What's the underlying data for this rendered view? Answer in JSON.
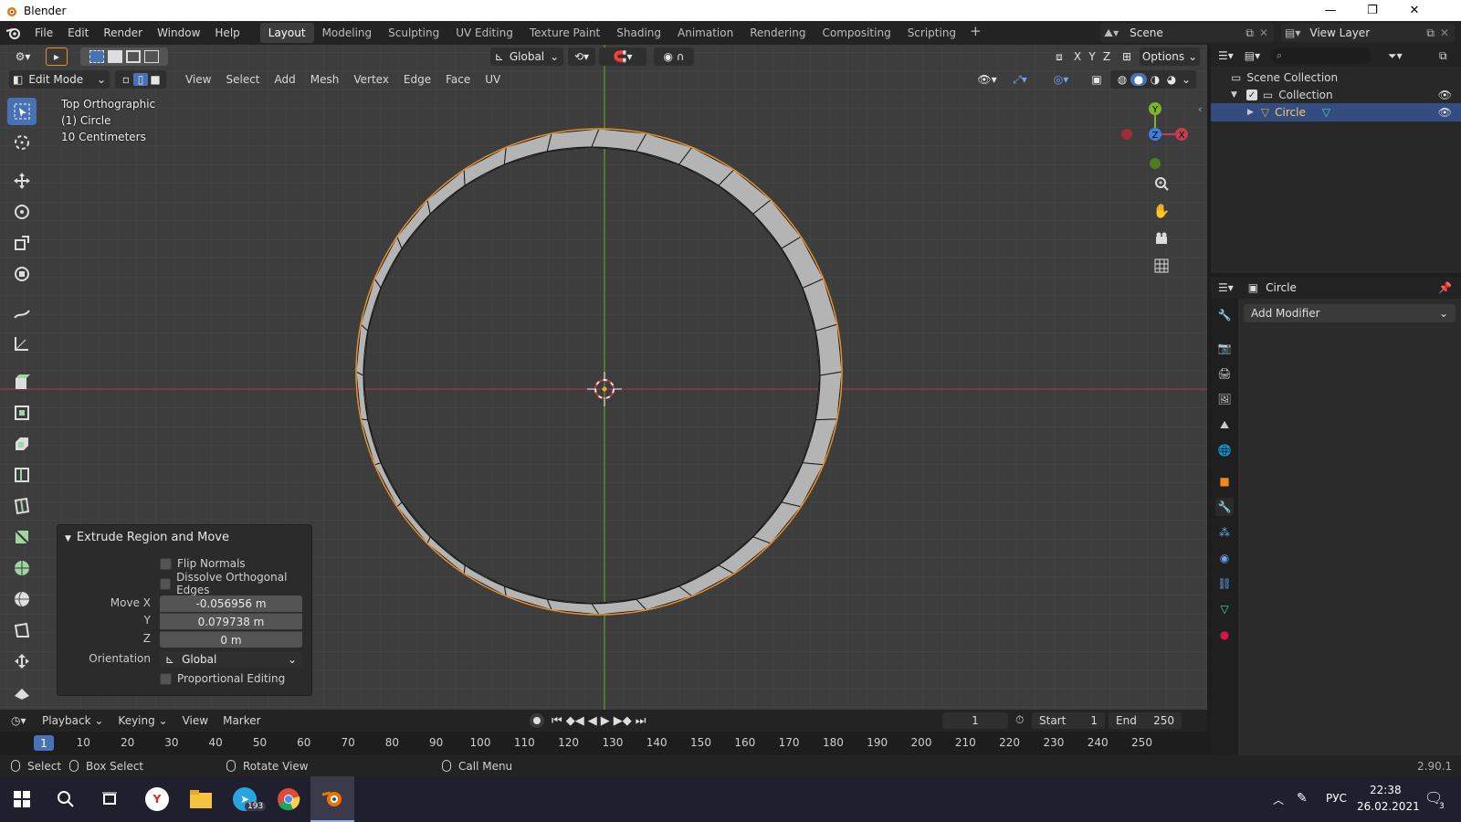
{
  "window": {
    "title": "Blender",
    "minimize": "—",
    "maximize": "❐",
    "close": "✕"
  },
  "menu": [
    "File",
    "Edit",
    "Render",
    "Window",
    "Help"
  ],
  "workspaces": [
    "Layout",
    "Modeling",
    "Sculpting",
    "UV Editing",
    "Texture Paint",
    "Shading",
    "Animation",
    "Rendering",
    "Compositing",
    "Scripting"
  ],
  "active_workspace": "Layout",
  "scene": {
    "label": "Scene",
    "view_layer": "View Layer"
  },
  "viewport": {
    "transform_orientation": "Global",
    "options_label": "Options",
    "axes": [
      "X",
      "Y",
      "Z"
    ],
    "mode": "Edit Mode",
    "header_menus": [
      "View",
      "Select",
      "Add",
      "Mesh",
      "Vertex",
      "Edge",
      "Face",
      "UV"
    ],
    "overlay_lines": [
      "Top Orthographic",
      "(1) Circle",
      "10 Centimeters"
    ],
    "gizmo": {
      "y": "Y",
      "z": "Z",
      "x": "X"
    }
  },
  "operator_panel": {
    "title": "Extrude Region and Move",
    "flip_normals": "Flip Normals",
    "dissolve_edges": "Dissolve Orthogonal Edges",
    "move_x_label": "Move X",
    "move_x": "-0.056956 m",
    "y_label": "Y",
    "y": "0.079738 m",
    "z_label": "Z",
    "z": "0 m",
    "orientation_label": "Orientation",
    "orientation": "Global",
    "proportional": "Proportional Editing"
  },
  "timeline": {
    "menus": [
      "Playback",
      "Keying",
      "View",
      "Marker"
    ],
    "current_frame": "1",
    "frame_field": "1",
    "start_label": "Start",
    "start": "1",
    "end_label": "End",
    "end": "250",
    "ruler": [
      "10",
      "20",
      "30",
      "40",
      "50",
      "60",
      "70",
      "80",
      "90",
      "100",
      "110",
      "120",
      "130",
      "140",
      "150",
      "160",
      "170",
      "180",
      "190",
      "200",
      "210",
      "220",
      "230",
      "240",
      "250"
    ]
  },
  "statusbar": {
    "select": "Select",
    "box_select": "Box Select",
    "rotate_view": "Rotate View",
    "call_menu": "Call Menu",
    "version": "2.90.1"
  },
  "outliner": {
    "scene_collection": "Scene Collection",
    "collection": "Collection",
    "object": "Circle"
  },
  "properties": {
    "object_name": "Circle",
    "add_modifier": "Add Modifier"
  },
  "taskbar": {
    "telegram_badge": "193",
    "lang": "РУС",
    "time": "22:38",
    "date": "26.02.2021",
    "notifications": "3"
  },
  "colors": {
    "accent": "#4772b3",
    "x_axis": "#c83c4f",
    "y_axis": "#7bb62a",
    "z_axis": "#3b7fe0",
    "selection_edge": "#e8912b"
  }
}
